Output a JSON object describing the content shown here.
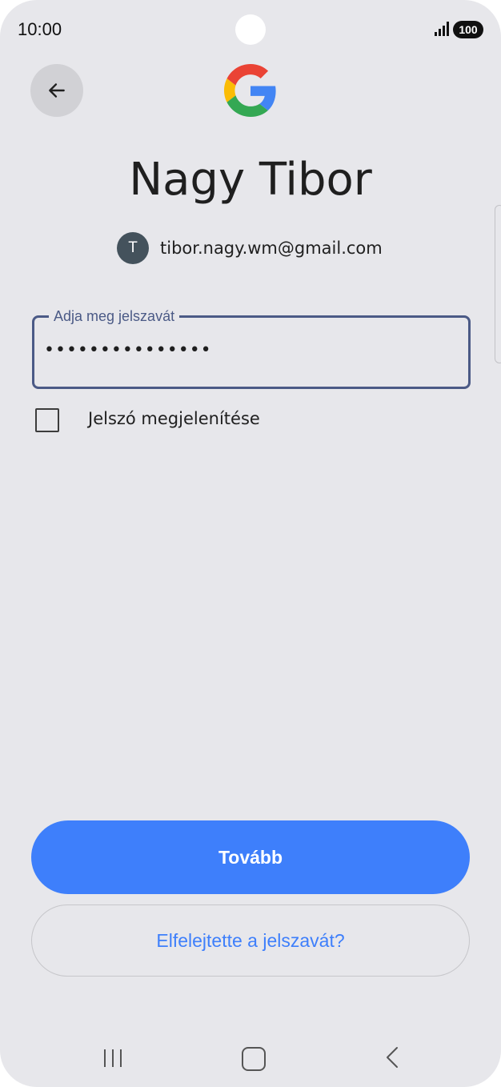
{
  "status_bar": {
    "time": "10:00",
    "battery": "100",
    "signal_icon": "signal-icon"
  },
  "header": {
    "back_icon": "arrow-left-icon",
    "logo": "google-logo"
  },
  "account": {
    "name": "Nagy Tibor",
    "avatar_letter": "T",
    "email": "tibor.nagy.wm@gmail.com",
    "avatar_color": "#44525c"
  },
  "password_field": {
    "label": "Adja meg jelszavát",
    "value": "•••••••••••••••"
  },
  "show_password": {
    "label": "Jelszó megjelenítése",
    "checked": false
  },
  "buttons": {
    "next": "Tovább",
    "forgot": "Elfelejtette a jelszavát?"
  },
  "colors": {
    "accent": "#3e7ffb",
    "field_border": "#4b5a86",
    "background": "#e7e7eb"
  },
  "nav_bar": {
    "recent_icon": "recent-apps-icon",
    "home_icon": "home-icon",
    "back_icon": "back-icon"
  }
}
